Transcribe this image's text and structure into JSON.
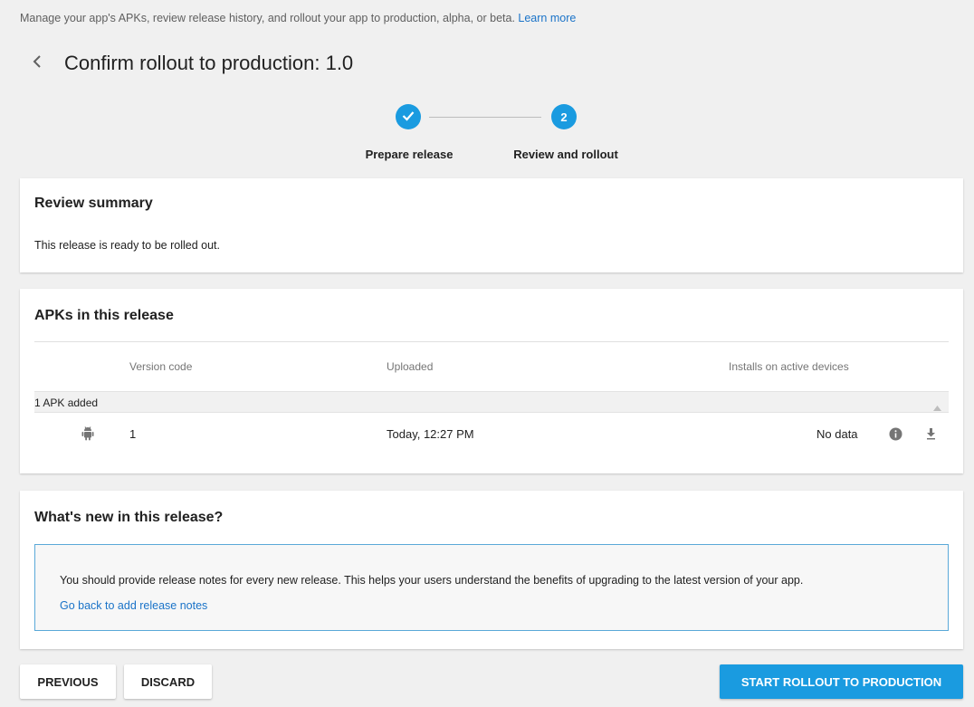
{
  "intro": {
    "text": "Manage your app's APKs, review release history, and rollout your app to production, alpha, or beta.",
    "link": "Learn more"
  },
  "header": {
    "back_icon": "chevron-left-icon",
    "title": "Confirm rollout to production: 1.0"
  },
  "stepper": {
    "steps": [
      {
        "label": "Prepare release",
        "state": "complete",
        "icon": "check-icon"
      },
      {
        "label": "Review and rollout",
        "state": "active",
        "number": "2"
      }
    ],
    "accent_color": "#1a9be0"
  },
  "review": {
    "title": "Review summary",
    "text": "This release is ready to be rolled out."
  },
  "apks": {
    "title": "APKs in this release",
    "columns": [
      "Version code",
      "Uploaded",
      "Installs on active devices"
    ],
    "group_label": "1 APK added",
    "rows": [
      {
        "icon": "android-icon",
        "version_code": "1",
        "uploaded": "Today, 12:27 PM",
        "installs": "No data",
        "actions": [
          "info-icon",
          "download-icon"
        ]
      }
    ]
  },
  "whats_new": {
    "title": "What's new in this release?",
    "message": "You should provide release notes for every new release. This helps your users understand the benefits of upgrading to the latest version of your app.",
    "link": "Go back to add release notes"
  },
  "footer": {
    "previous": "PREVIOUS",
    "discard": "DISCARD",
    "start": "START ROLLOUT TO PRODUCTION"
  }
}
